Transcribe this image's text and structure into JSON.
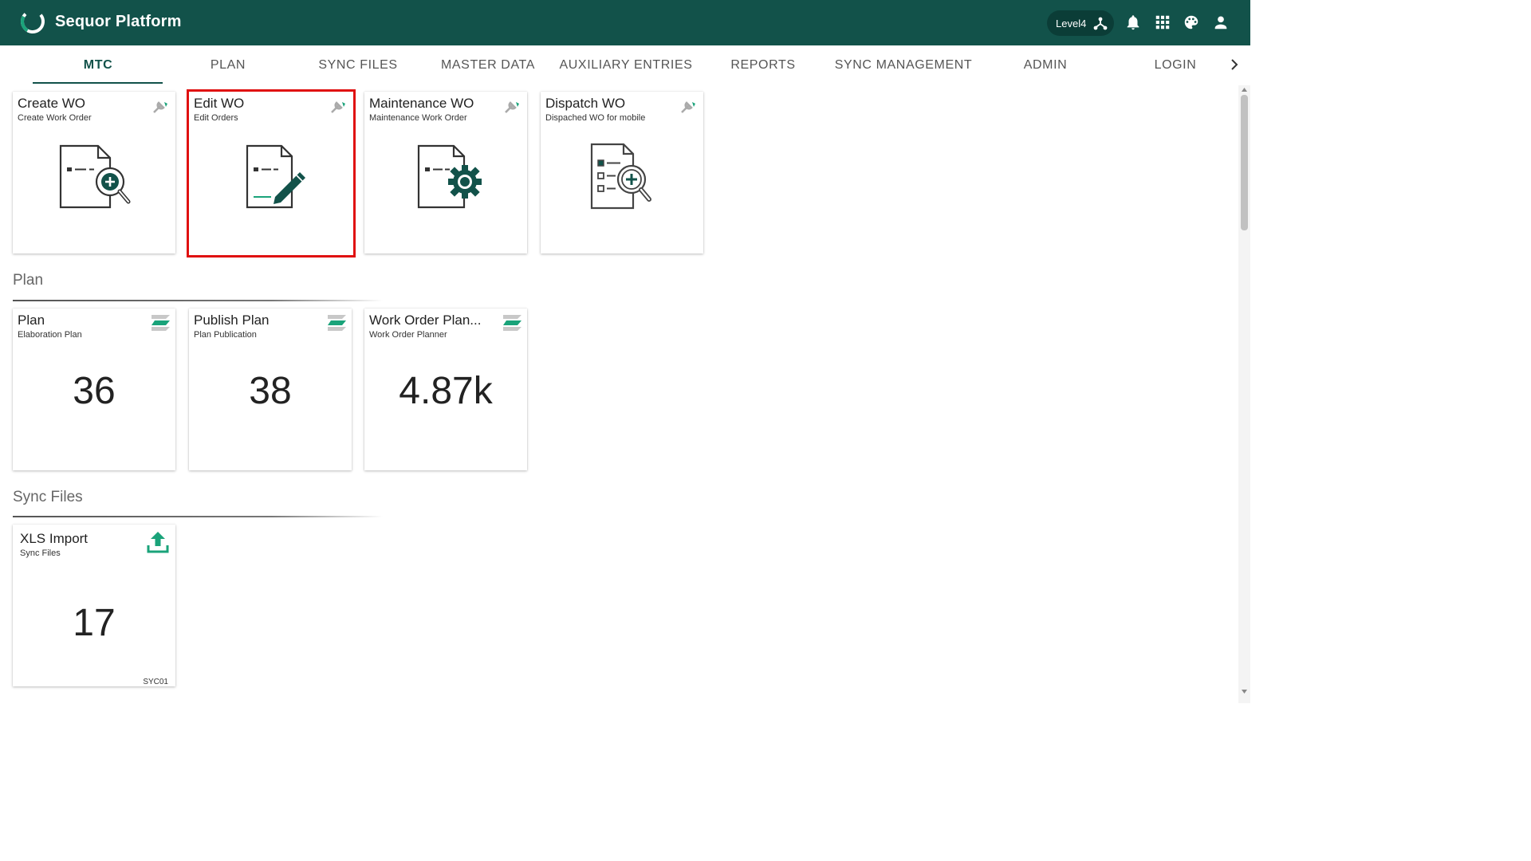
{
  "header": {
    "app_title": "Sequor Platform",
    "level_label": "Level4",
    "icons": [
      "hierarchy-icon",
      "bell-icon",
      "apps-grid-icon",
      "palette-icon",
      "user-icon"
    ],
    "brand_color": "#12524a",
    "accent_color": "#1aa37a"
  },
  "tabs": [
    {
      "label": "MTC",
      "active": true
    },
    {
      "label": "PLAN"
    },
    {
      "label": "SYNC FILES"
    },
    {
      "label": "MASTER DATA"
    },
    {
      "label": "AUXILIARY ENTRIES"
    },
    {
      "label": "REPORTS"
    },
    {
      "label": "SYNC MANAGEMENT"
    },
    {
      "label": "ADMIN"
    },
    {
      "label": "LOGIN"
    }
  ],
  "mtc": {
    "cards": [
      {
        "title": "Create WO",
        "subtitle": "Create Work Order",
        "icon": "create-document-icon"
      },
      {
        "title": "Edit WO",
        "subtitle": "Edit Orders",
        "icon": "edit-document-icon",
        "selected": true
      },
      {
        "title": "Maintenance WO",
        "subtitle": "Maintenance Work Order",
        "icon": "maintenance-document-icon"
      },
      {
        "title": "Dispatch WO",
        "subtitle": "Dispached WO for mobile",
        "icon": "dispatch-document-icon"
      }
    ]
  },
  "plan": {
    "section_title": "Plan",
    "cards": [
      {
        "title": "Plan",
        "subtitle": "Elaboration Plan",
        "count": "36"
      },
      {
        "title": "Publish Plan",
        "subtitle": "Plan Publication",
        "count": "38"
      },
      {
        "title": "Work Order Plan...",
        "subtitle": "Work Order Planner",
        "count": "4.87k"
      }
    ]
  },
  "sync_files": {
    "section_title": "Sync Files",
    "cards": [
      {
        "title": "XLS Import",
        "subtitle": "Sync Files",
        "count": "17",
        "code": "SYC01"
      }
    ]
  }
}
